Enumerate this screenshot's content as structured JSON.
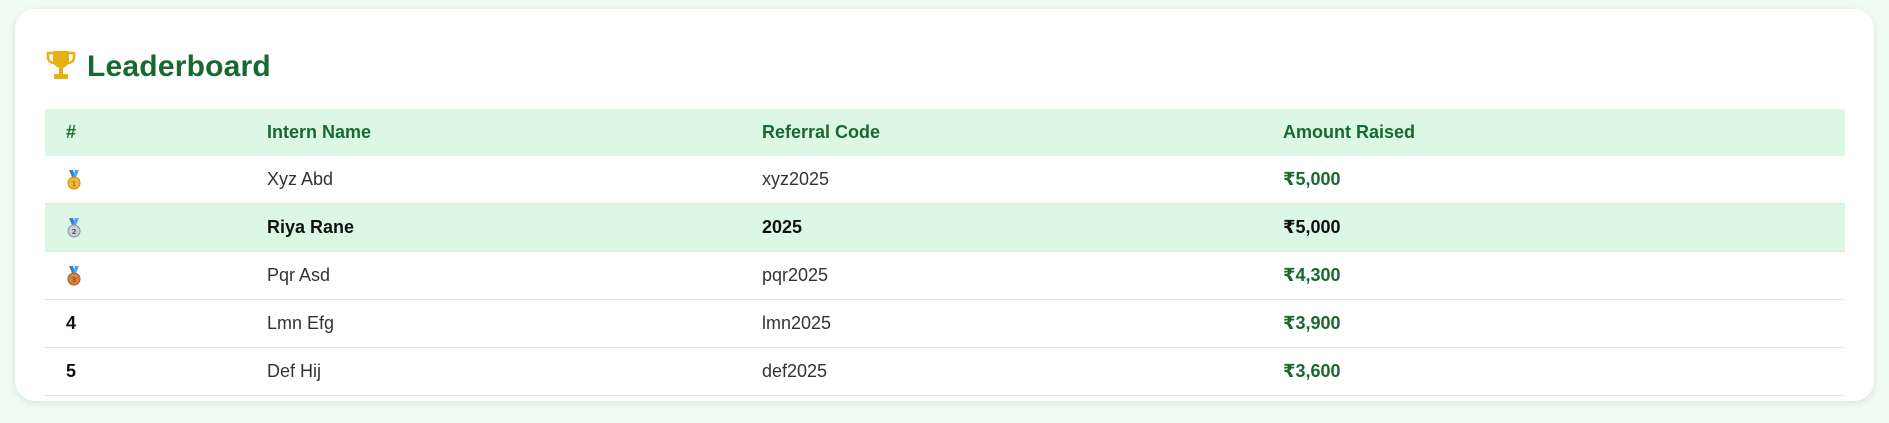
{
  "leaderboard": {
    "title": "Leaderboard",
    "title_icon": "trophy-icon",
    "headers": {
      "rank": "#",
      "name": "Intern Name",
      "code": "Referral Code",
      "amount": "Amount Raised"
    },
    "rows": [
      {
        "rank": "1",
        "rank_icon": "gold-medal-icon",
        "name": "Xyz Abd",
        "code": "xyz2025",
        "amount": "₹5,000"
      },
      {
        "rank": "2",
        "rank_icon": "silver-medal-icon",
        "name": "Riya Rane",
        "code": "2025",
        "amount": "₹5,000",
        "highlighted": true
      },
      {
        "rank": "3",
        "rank_icon": "bronze-medal-icon",
        "name": "Pqr Asd",
        "code": "pqr2025",
        "amount": "₹4,300"
      },
      {
        "rank": "4",
        "name": "Lmn Efg",
        "code": "lmn2025",
        "amount": "₹3,900"
      },
      {
        "rank": "5",
        "name": "Def Hij",
        "code": "def2025",
        "amount": "₹3,600"
      }
    ]
  },
  "colors": {
    "accent": "#17692f",
    "header_bg": "#dcf8e4",
    "page_bg": "#f0fbf3",
    "trophy": "#e8b10f"
  }
}
